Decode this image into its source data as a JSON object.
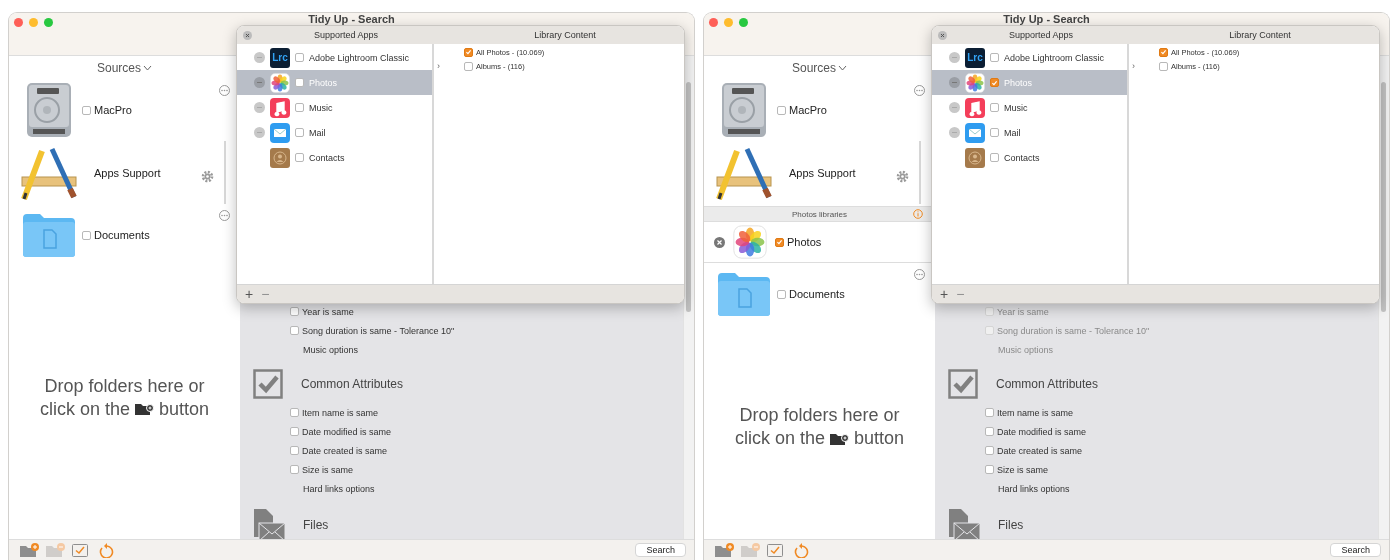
{
  "windows": [
    {
      "title": "Tidy Up - Search",
      "sources_label": "Sources",
      "sources": [
        {
          "kind": "drive",
          "label": "MacPro",
          "checked": false
        },
        {
          "kind": "apps",
          "label": "Apps Support"
        },
        {
          "kind": "folder",
          "label": "Documents",
          "checked": false
        }
      ],
      "drop_hint": {
        "line_1": "Drop folders here or",
        "line_2_before": "click on the",
        "line_2_after": "button"
      },
      "options": [
        {
          "kind": "check",
          "label": "Year is same",
          "checked": false,
          "disabled": false
        },
        {
          "kind": "check",
          "label": "Song duration is same - Tolerance 10\"",
          "checked": false,
          "disabled": false
        },
        {
          "kind": "link",
          "label": "Music options",
          "disabled": false
        },
        {
          "kind": "checkheading",
          "label": "Common Attributes"
        },
        {
          "kind": "check",
          "label": "Item name is same",
          "checked": false,
          "disabled": false
        },
        {
          "kind": "check",
          "label": "Date modified is same",
          "checked": false,
          "disabled": false
        },
        {
          "kind": "check",
          "label": "Date created is same",
          "checked": false,
          "disabled": false
        },
        {
          "kind": "check",
          "label": "Size is same",
          "checked": false,
          "disabled": false
        },
        {
          "kind": "link",
          "label": "Hard links options",
          "disabled": false
        },
        {
          "kind": "fileheading",
          "label": "Files"
        }
      ],
      "popover": {
        "apps_title": "Supported Apps",
        "content_title": "Library Content",
        "apps": [
          {
            "kind": "lightroom",
            "icon_text": "Lrc",
            "label": "Adobe Lightroom Classic",
            "removable": true,
            "checked": false,
            "selected": false
          },
          {
            "kind": "photos",
            "label": "Photos",
            "removable": true,
            "checked": false,
            "selected": true
          },
          {
            "kind": "music",
            "label": "Music",
            "removable": true,
            "checked": false,
            "selected": false
          },
          {
            "kind": "mail",
            "label": "Mail",
            "removable": true,
            "checked": false,
            "selected": false
          },
          {
            "kind": "contacts",
            "label": "Contacts",
            "removable": false,
            "checked": false,
            "selected": false
          }
        ],
        "content": [
          {
            "label": "All Photos - (10.069)",
            "checked": true
          },
          {
            "chevron": "›",
            "label": "Albums - (116)",
            "checked": false
          }
        ],
        "footer": [
          {
            "label": "+",
            "disabled": false
          },
          {
            "label": "−",
            "disabled": true
          }
        ]
      },
      "toolbar": [
        {
          "kind": "addfolder",
          "disabled": false
        },
        {
          "kind": "removefolder",
          "disabled": true
        },
        {
          "kind": "select",
          "disabled": false
        },
        {
          "kind": "revert",
          "disabled": false
        }
      ],
      "search_button": "Search"
    },
    {
      "title": "Tidy Up - Search",
      "sources_label": "Sources",
      "sources": [
        {
          "kind": "drive",
          "label": "MacPro",
          "checked": false
        },
        {
          "kind": "apps",
          "label": "Apps Support"
        },
        {
          "kind": "group",
          "label": "Photos libraries"
        },
        {
          "kind": "library",
          "label": "Photos",
          "checked": true
        },
        {
          "kind": "folder",
          "label": "Documents",
          "checked": false
        }
      ],
      "drop_hint": {
        "line_1": "Drop folders here or",
        "line_2_before": "click on the",
        "line_2_after": "button"
      },
      "options": [
        {
          "kind": "check",
          "label": "Year is same",
          "checked": false,
          "disabled": true
        },
        {
          "kind": "check",
          "label": "Song duration is same - Tolerance 10\"",
          "checked": false,
          "disabled": true
        },
        {
          "kind": "link",
          "label": "Music options",
          "disabled": true
        },
        {
          "kind": "checkheading",
          "label": "Common Attributes"
        },
        {
          "kind": "check",
          "label": "Item name is same",
          "checked": false,
          "disabled": false
        },
        {
          "kind": "check",
          "label": "Date modified is same",
          "checked": false,
          "disabled": false
        },
        {
          "kind": "check",
          "label": "Date created is same",
          "checked": false,
          "disabled": false
        },
        {
          "kind": "check",
          "label": "Size is same",
          "checked": false,
          "disabled": false
        },
        {
          "kind": "link",
          "label": "Hard links options",
          "disabled": false
        },
        {
          "kind": "fileheading",
          "label": "Files"
        }
      ],
      "popover": {
        "apps_title": "Supported Apps",
        "content_title": "Library Content",
        "apps": [
          {
            "kind": "lightroom",
            "icon_text": "Lrc",
            "label": "Adobe Lightroom Classic",
            "removable": true,
            "checked": false,
            "selected": false
          },
          {
            "kind": "photos",
            "label": "Photos",
            "removable": true,
            "checked": true,
            "selected": true
          },
          {
            "kind": "music",
            "label": "Music",
            "removable": true,
            "checked": false,
            "selected": false
          },
          {
            "kind": "mail",
            "label": "Mail",
            "removable": true,
            "checked": false,
            "selected": false
          },
          {
            "kind": "contacts",
            "label": "Contacts",
            "removable": false,
            "checked": false,
            "selected": false
          }
        ],
        "content": [
          {
            "label": "All Photos - (10.069)",
            "checked": true
          },
          {
            "chevron": "›",
            "label": "Albums - (116)",
            "checked": false
          }
        ],
        "footer": [
          {
            "label": "+",
            "disabled": false
          },
          {
            "label": "−",
            "disabled": true
          }
        ]
      },
      "toolbar": [
        {
          "kind": "addfolder",
          "disabled": false
        },
        {
          "kind": "removefolder",
          "disabled": true
        },
        {
          "kind": "select",
          "disabled": false
        },
        {
          "kind": "revert",
          "disabled": false
        }
      ],
      "search_button": "Search"
    }
  ]
}
